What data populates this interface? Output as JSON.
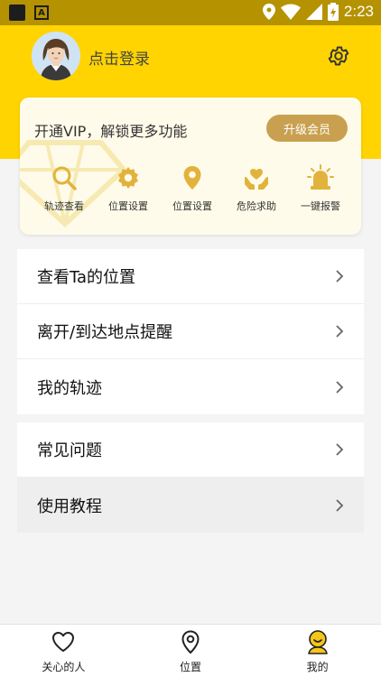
{
  "status_bar": {
    "time": "2:23"
  },
  "header": {
    "login_text": "点击登录"
  },
  "vip": {
    "title": "开通VIP，解锁更多功能",
    "upgrade_label": "升级会员",
    "features": [
      {
        "label": "轨迹查看",
        "icon": "search-icon"
      },
      {
        "label": "位置设置",
        "icon": "gear-icon"
      },
      {
        "label": "位置设置",
        "icon": "location-pin-icon"
      },
      {
        "label": "危险求助",
        "icon": "heart-hands-icon"
      },
      {
        "label": "一键报警",
        "icon": "alarm-light-icon"
      }
    ]
  },
  "menu_primary": [
    {
      "label": "查看Ta的位置"
    },
    {
      "label": "离开/到达地点提醒"
    },
    {
      "label": "我的轨迹"
    }
  ],
  "menu_secondary": [
    {
      "label": "常见问题"
    },
    {
      "label": "使用教程"
    }
  ],
  "bottom_nav": [
    {
      "label": "关心的人",
      "icon": "heart-icon"
    },
    {
      "label": "位置",
      "icon": "location-pin-icon"
    },
    {
      "label": "我的",
      "icon": "profile-face-icon",
      "active": true
    }
  ],
  "colors": {
    "header": "#ffd400",
    "accent_gold": "#c9a04f",
    "status_bar": "#b59200"
  }
}
